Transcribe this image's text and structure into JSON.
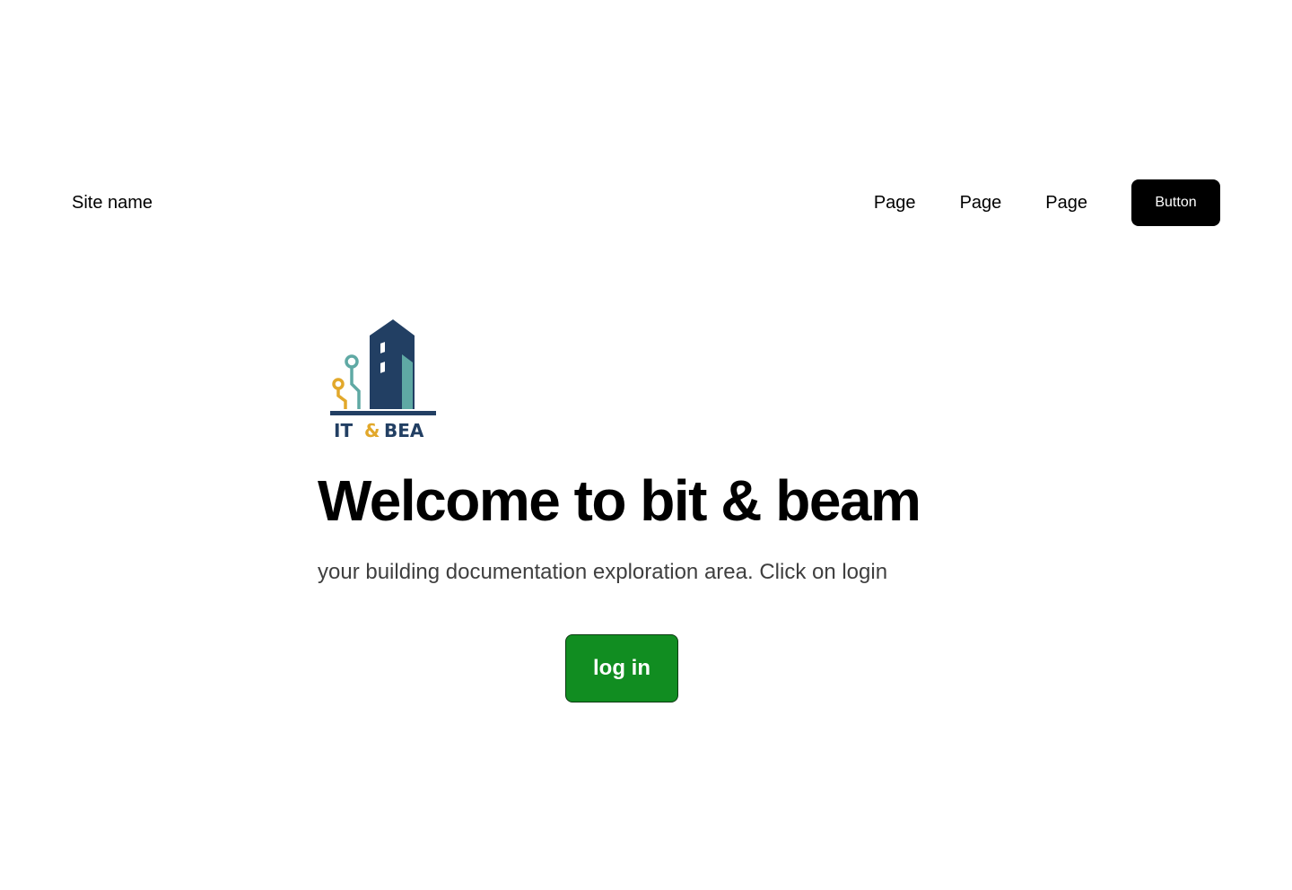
{
  "header": {
    "site_name": "Site name",
    "nav": [
      "Page",
      "Page",
      "Page"
    ],
    "button_label": "Button"
  },
  "logo": {
    "icon": "building-circuit-logo",
    "text_part1": "IT",
    "text_amp": "&",
    "text_part2": "BEA",
    "colors": {
      "navy": "#223f63",
      "teal": "#5fa9a4",
      "gold": "#e2a82b"
    }
  },
  "hero": {
    "title": "Welcome to bit & beam",
    "subtitle": "your building documentation exploration area. Click on login",
    "login_label": "log in"
  },
  "colors": {
    "login_green": "#118d21",
    "header_button": "#000000",
    "subtitle_gray": "#3f3f3f"
  }
}
